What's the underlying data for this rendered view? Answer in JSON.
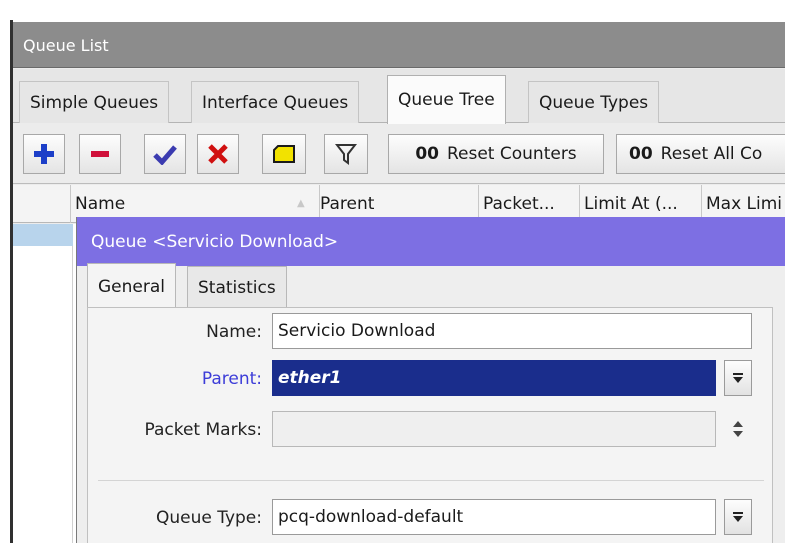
{
  "window": {
    "title": "Queue List"
  },
  "tabs": [
    {
      "label": "Simple Queues",
      "active": false
    },
    {
      "label": "Interface Queues",
      "active": false
    },
    {
      "label": "Queue Tree",
      "active": true
    },
    {
      "label": "Queue Types",
      "active": false
    }
  ],
  "toolbar": {
    "add_icon": "plus-icon",
    "remove_icon": "minus-icon",
    "enable_icon": "check-icon",
    "disable_icon": "x-icon",
    "comment_icon": "note-icon",
    "filter_icon": "filter-icon",
    "counter_prefix": "00",
    "reset_counters_label": "Reset Counters",
    "reset_all_counters_prefix": "00",
    "reset_all_counters_label": "Reset All Co",
    "colors": {
      "add": "#1c3fc8",
      "remove": "#d0103a",
      "enable": "#3b3bb0",
      "disable": "#d01010",
      "comment": "#f2e200"
    }
  },
  "table": {
    "columns": [
      "Name",
      "Parent",
      "Packet...",
      "Limit At (...",
      "Max Limi"
    ]
  },
  "dialog": {
    "title": "Queue <Servicio Download>",
    "title_color": "#7d6fe3",
    "tabs": [
      {
        "label": "General",
        "active": true
      },
      {
        "label": "Statistics",
        "active": false
      }
    ],
    "fields": {
      "name_label": "Name:",
      "name_value": "Servicio Download",
      "parent_label": "Parent:",
      "parent_value": "ether1",
      "packet_marks_label": "Packet Marks:",
      "packet_marks_value": "",
      "queue_type_label": "Queue Type:",
      "queue_type_value": "pcq-download-default"
    }
  }
}
